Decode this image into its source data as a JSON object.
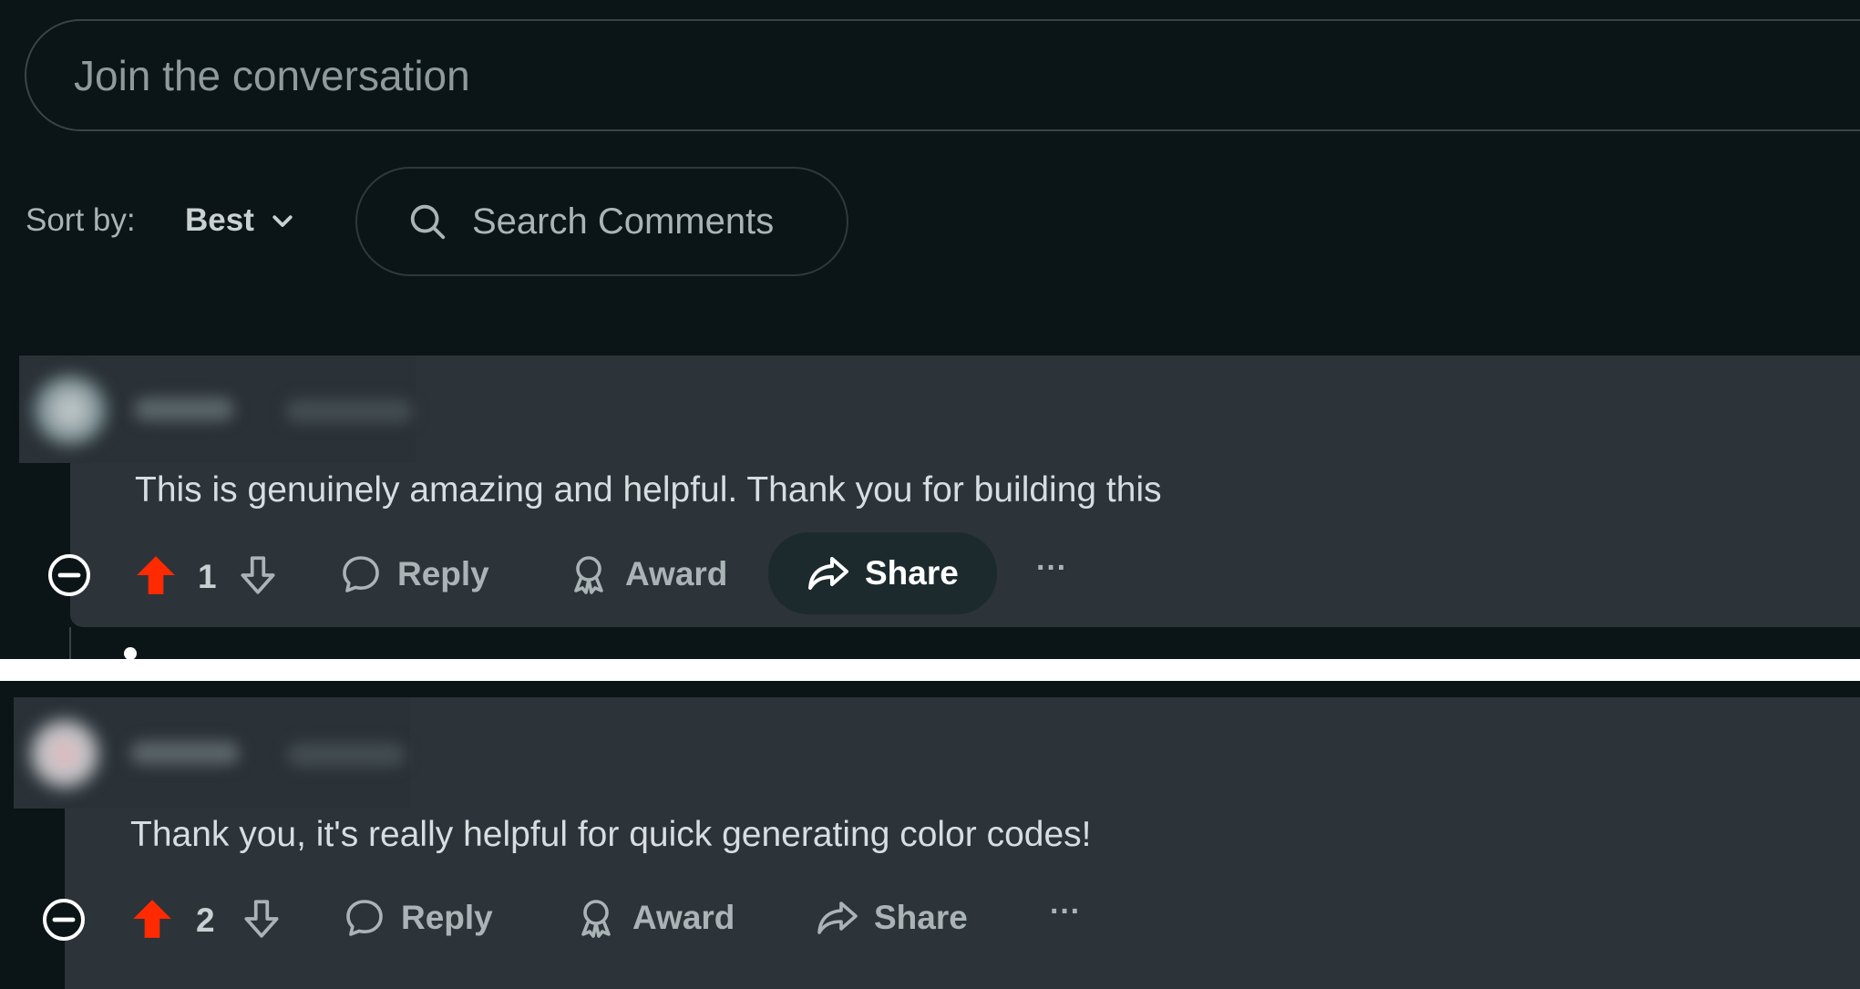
{
  "composer": {
    "placeholder": "Join the conversation"
  },
  "sort": {
    "label": "Sort by:",
    "value": "Best"
  },
  "search": {
    "label": "Search Comments"
  },
  "comments": [
    {
      "text": "This is genuinely amazing and helpful. Thank you for building this",
      "score": "1",
      "reply_label": "Reply",
      "award_label": "Award",
      "share_label": "Share",
      "more_label": "···"
    },
    {
      "text": "Thank you, it's really helpful for quick generating color codes!",
      "score": "2",
      "reply_label": "Reply",
      "award_label": "Award",
      "share_label": "Share",
      "more_label": "···"
    }
  ],
  "colors": {
    "background": "#0b1416",
    "card": "#2c3339",
    "upvote": "#ff2a00",
    "text": "#d7dde0",
    "muted": "#aab4b6"
  },
  "icons": [
    "search-icon",
    "chevron-down-icon",
    "collapse-icon",
    "upvote-icon",
    "downvote-icon",
    "reply-icon",
    "award-icon",
    "share-icon",
    "more-icon"
  ]
}
